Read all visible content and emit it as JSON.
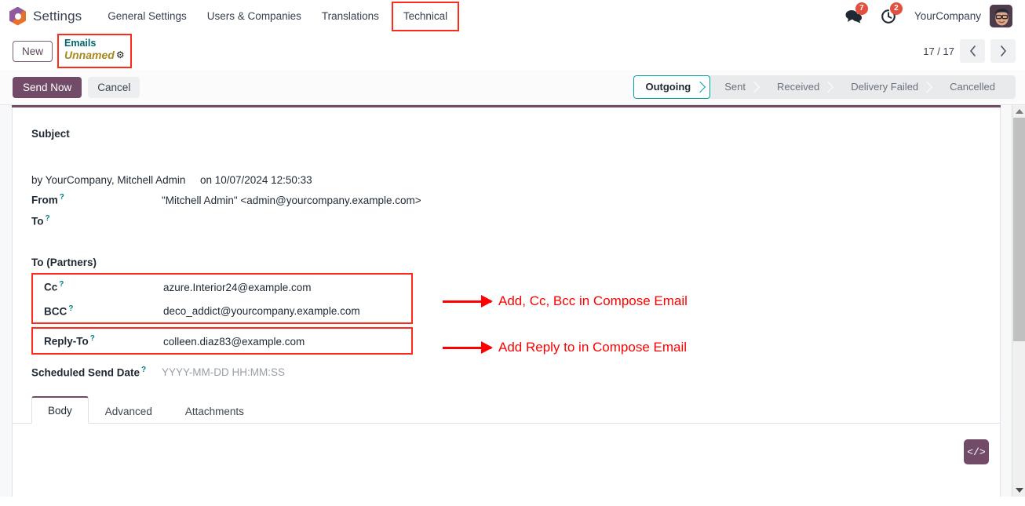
{
  "navbar": {
    "brand": "Settings",
    "logo_icon": "odoo-hexagon-logo",
    "menu": [
      {
        "label": "General Settings",
        "highlighted": false
      },
      {
        "label": "Users & Companies",
        "highlighted": false
      },
      {
        "label": "Translations",
        "highlighted": false
      },
      {
        "label": "Technical",
        "highlighted": true
      }
    ],
    "messages": {
      "icon": "chat-bubble-icon",
      "count": "7"
    },
    "activities": {
      "icon": "clock-activity-icon",
      "count": "2"
    },
    "company": "YourCompany",
    "avatar_icon": "user-avatar"
  },
  "breadcrumb": {
    "new_label": "New",
    "parent": "Emails",
    "current": "Unnamed",
    "gear_icon": "gear-icon"
  },
  "pager": {
    "count": "17 / 17",
    "prev_icon": "chevron-left-icon",
    "next_icon": "chevron-right-icon"
  },
  "actions": {
    "send_now": "Send Now",
    "cancel": "Cancel"
  },
  "statusbar": {
    "stages": [
      {
        "label": "Outgoing",
        "active": true
      },
      {
        "label": "Sent",
        "active": false
      },
      {
        "label": "Received",
        "active": false
      },
      {
        "label": "Delivery Failed",
        "active": false
      },
      {
        "label": "Cancelled",
        "active": false
      }
    ]
  },
  "form": {
    "subject_label": "Subject",
    "subject_value": "",
    "meta_by": "by YourCompany, Mitchell Admin",
    "meta_on": "on 10/07/2024 12:50:33",
    "from_label": "From",
    "from_value": "\"Mitchell Admin\" <admin@yourcompany.example.com>",
    "to_label": "To",
    "to_value": "",
    "to_partners_label": "To (Partners)",
    "to_partners_value": "",
    "cc_label": "Cc",
    "cc_value": "azure.Interior24@example.com",
    "bcc_label": "BCC",
    "bcc_value": "deco_addict@yourcompany.example.com",
    "reply_to_label": "Reply-To",
    "reply_to_value": "colleen.diaz83@example.com",
    "scheduled_label": "Scheduled Send Date",
    "scheduled_placeholder": "YYYY-MM-DD HH:MM:SS",
    "tooltip_marker": "?"
  },
  "notebook": {
    "tabs": [
      {
        "label": "Body",
        "active": true
      },
      {
        "label": "Advanced",
        "active": false
      },
      {
        "label": "Attachments",
        "active": false
      }
    ],
    "code_button_icon": "code-icon",
    "code_button_label": "</>"
  },
  "annotations": [
    {
      "text": "Add, Cc, Bcc in Compose Email",
      "target": "cc-bcc-fields"
    },
    {
      "text": "Add Reply to in Compose Email",
      "target": "reply-to-field"
    }
  ],
  "colors": {
    "primary": "#714b67",
    "accent_teal": "#00a09d",
    "annotation_red": "#ff0000",
    "breadcrumb_parent": "#01666b",
    "breadcrumb_current": "#a8891c",
    "badge": "#e3503e"
  }
}
